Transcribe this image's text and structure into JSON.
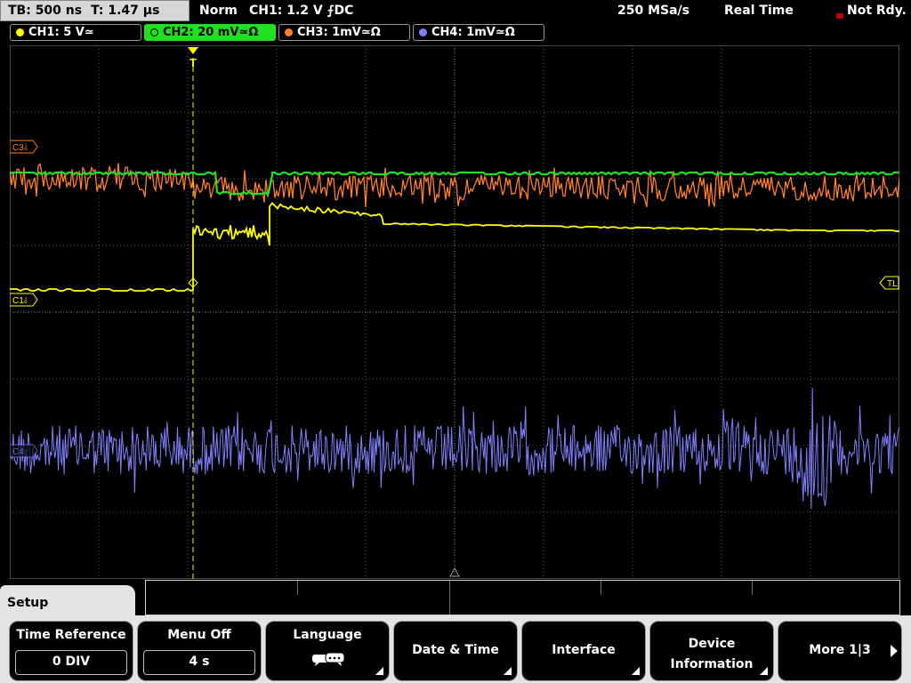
{
  "status": {
    "timebase": "TB: 500 ns",
    "trigger_time": "T: 1.47 µs",
    "trigger_mode": "Norm",
    "trigger_setting": "CH1: 1.2 V ⨍DC",
    "sample_rate": "250 MSa/s",
    "acq_mode": "Real Time",
    "ready_state": "Not Rdy."
  },
  "channels": [
    {
      "label": "CH1: 5 V≃",
      "color": "#ffff00",
      "active": false
    },
    {
      "label": "CH2: 20 mV≃Ω",
      "color": "#20e020",
      "active": true
    },
    {
      "label": "CH3: 1mV≃Ω",
      "color": "#ff7f2a",
      "active": false
    },
    {
      "label": "CH4: 1mV≃Ω",
      "color": "#8080ff",
      "active": false
    }
  ],
  "markers": {
    "ch3": "C3⫰",
    "ch1": "C1⫰",
    "ch4": "C4",
    "trigger_level": "TL",
    "trigger_pos": "T"
  },
  "menu": {
    "title": "Setup",
    "time_reference": {
      "label": "Time Reference",
      "value": "0 DIV"
    },
    "menu_off": {
      "label": "Menu Off",
      "value": "4 s"
    },
    "language": {
      "label": "Language",
      "icon": "speech-bubbles-icon"
    },
    "date_time": {
      "label": "Date & Time"
    },
    "interface": {
      "label": "Interface"
    },
    "device_info": {
      "label1": "Device",
      "label2": "Information"
    },
    "more": {
      "label": "More 1|3"
    }
  }
}
